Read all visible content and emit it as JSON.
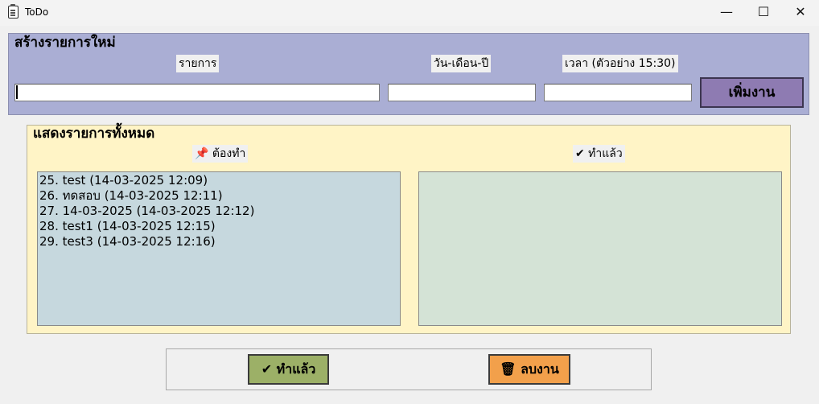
{
  "window": {
    "title": "ToDo",
    "minimize_glyph": "—",
    "maximize_glyph": "☐",
    "close_glyph": "✕"
  },
  "new_task": {
    "legend": "สร้างรายการใหม่",
    "task_label": "รายการ",
    "date_label": "วัน-เดือน-ปี",
    "time_label": "เวลา (ตัวอย่าง 15:30)",
    "task_value": "",
    "date_value": "",
    "time_value": "",
    "add_button": "เพิ่มงาน"
  },
  "list_section": {
    "legend": "แสดงรายการทั้งหมด",
    "todo_header": "📌 ต้องทำ",
    "done_header": "✔ ทำแล้ว",
    "todo_items": [
      "25. test (14-03-2025 12:09)",
      "26. ทดสอบ (14-03-2025 12:11)",
      "27. 14-03-2025 (14-03-2025 12:12)",
      "28. test1 (14-03-2025 12:15)",
      "29. test3 (14-03-2025 12:16)"
    ],
    "done_items": []
  },
  "actions": {
    "done_button": "✔ ทำแล้ว",
    "delete_button": "🗑 ลบงาน"
  },
  "icons": {
    "app": "clipboard-icon",
    "pin": "pushpin-icon",
    "check": "checkmark-icon",
    "trash": "trash-icon"
  },
  "colors": {
    "new_task_bg": "#aaaed4",
    "list_section_bg": "#fff4c6",
    "add_button_bg": "#8e7bb2",
    "todo_list_bg": "#c6d8de",
    "done_list_bg": "#d4e3d6",
    "done_button_bg": "#9cb067",
    "delete_button_bg": "#f2a04b"
  }
}
